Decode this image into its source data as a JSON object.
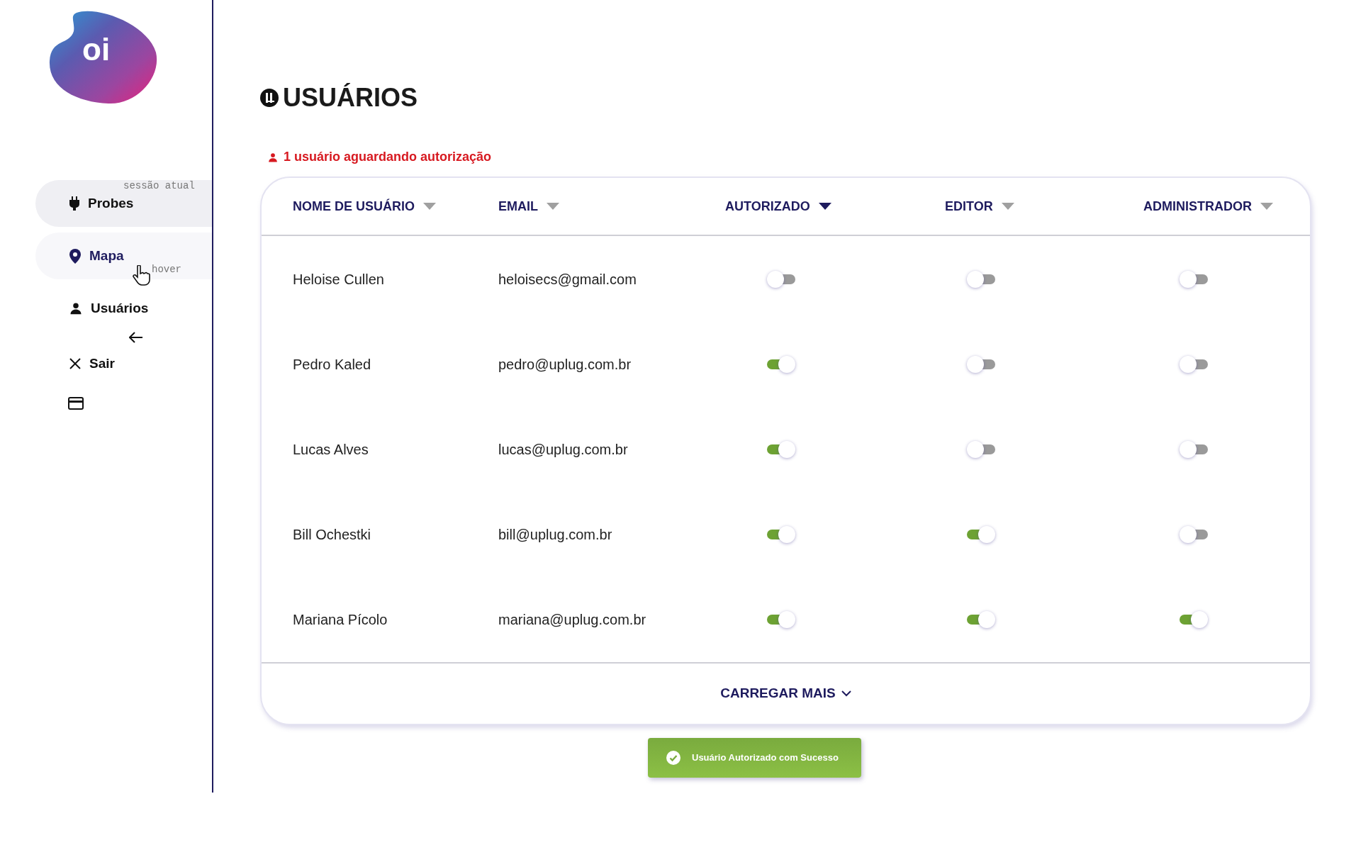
{
  "logo": {
    "text": "oi"
  },
  "sidebar": {
    "items": [
      {
        "label": "Probes",
        "kind": "plug",
        "selected": true,
        "hovered": false,
        "note": "sessão atual"
      },
      {
        "label": "Mapa",
        "kind": "pin",
        "selected": false,
        "hovered": true,
        "note": "hover"
      },
      {
        "label": "Usuários",
        "kind": "user",
        "selected": false,
        "hovered": false
      },
      {
        "label": "Sair",
        "kind": "close",
        "selected": false,
        "hovered": false
      }
    ]
  },
  "page": {
    "title": "USUÁRIOS",
    "alert": "1 usuário aguardando autorização"
  },
  "table": {
    "columns": [
      {
        "label": "NOME DE USUÁRIO",
        "sorted": false
      },
      {
        "label": "EMAIL",
        "sorted": false
      },
      {
        "label": "AUTORIZADO",
        "sorted": true
      },
      {
        "label": "EDITOR",
        "sorted": false
      },
      {
        "label": "ADMINISTRADOR",
        "sorted": false
      }
    ],
    "rows": [
      {
        "name": "Heloise Cullen",
        "email": "heloisecs@gmail.com",
        "authorized": false,
        "editor": false,
        "admin": false
      },
      {
        "name": "Pedro Kaled",
        "email": "pedro@uplug.com.br",
        "authorized": true,
        "editor": false,
        "admin": false
      },
      {
        "name": "Lucas Alves",
        "email": "lucas@uplug.com.br",
        "authorized": true,
        "editor": false,
        "admin": false
      },
      {
        "name": "Bill Ochestki",
        "email": "bill@uplug.com.br",
        "authorized": true,
        "editor": true,
        "admin": false
      },
      {
        "name": "Mariana Pícolo",
        "email": "mariana@uplug.com.br",
        "authorized": true,
        "editor": true,
        "admin": true
      }
    ],
    "load_more": "CARREGAR MAIS"
  },
  "toast": {
    "message": "Usuário Autorizado com Sucesso"
  }
}
